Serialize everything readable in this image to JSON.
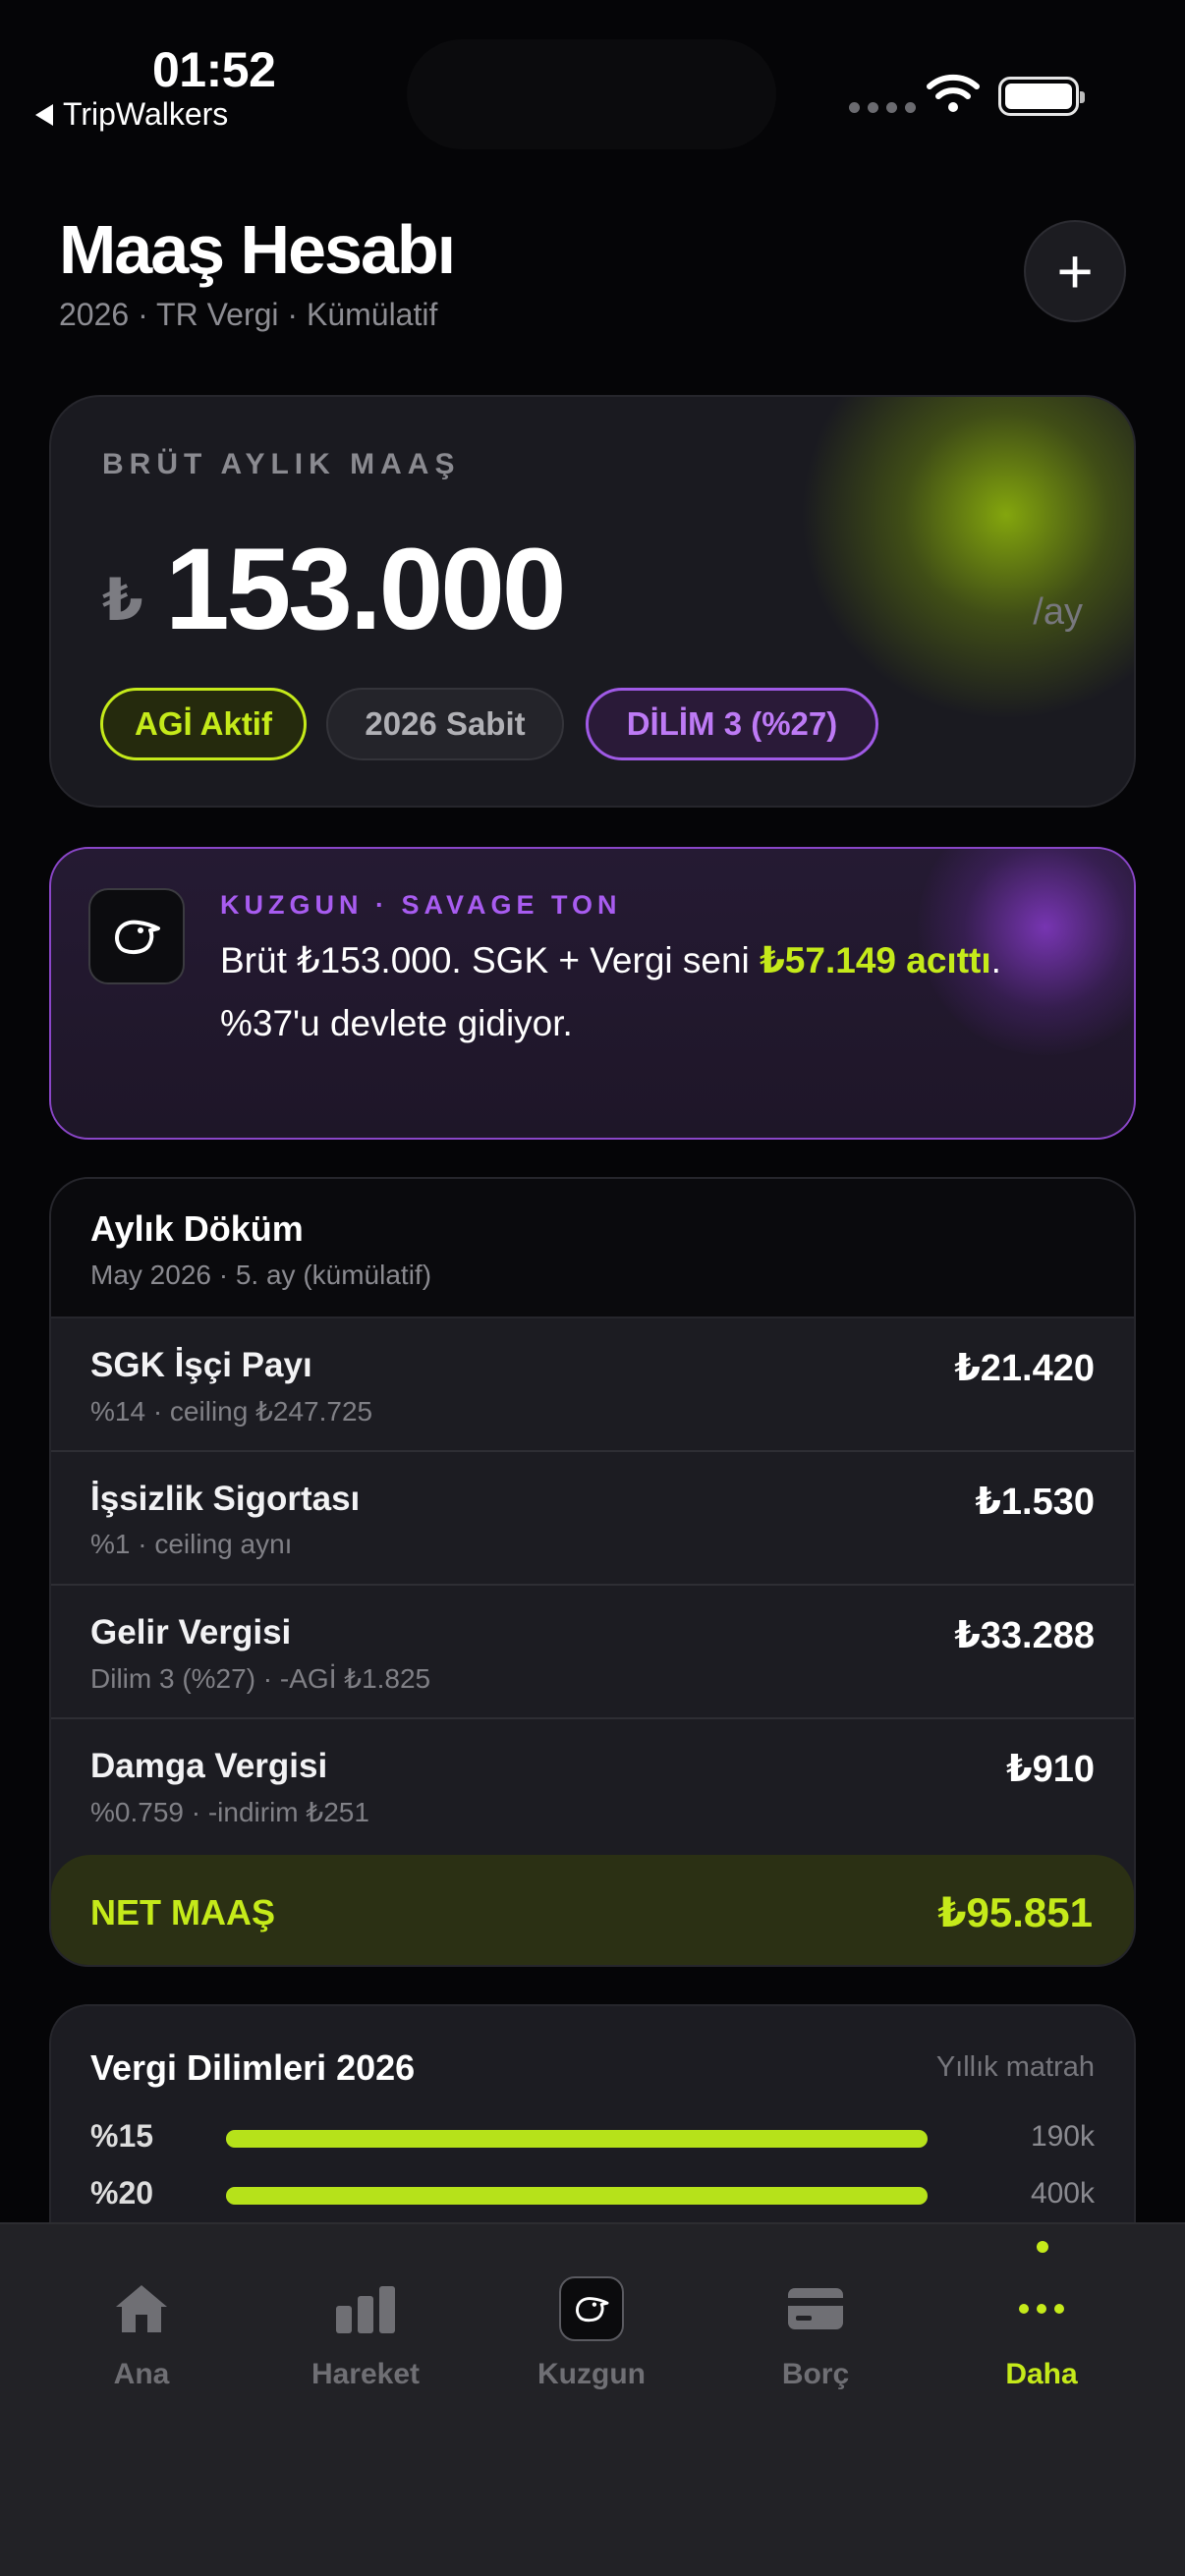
{
  "status": {
    "time": "01:52",
    "back_app": "TripWalkers"
  },
  "header": {
    "title": "Maaş Hesabı",
    "subtitle": "2026 · TR Vergi · Kümülatif",
    "add_label": "+"
  },
  "salary": {
    "label": "BRÜT AYLIK MAAŞ",
    "currency": "₺",
    "value": "153.000",
    "period": "/ay",
    "chips": {
      "agi": "AGİ Aktif",
      "sabit": "2026 Sabit",
      "dilim": "DİLİM 3 (%27)"
    }
  },
  "kuzgun": {
    "tag": "KUZGUN · SAVAGE TON",
    "text_pre": "Brüt ₺153.000. SGK + Vergi seni ",
    "text_highlight": "₺57.149 acıttı",
    "text_post": ". %37'u devlete gidiyor."
  },
  "breakdown": {
    "title": "Aylık Döküm",
    "subtitle": "May 2026 · 5. ay (kümülatif)",
    "rows": [
      {
        "name": "SGK İşçi Payı",
        "desc": "%14 · ceiling ₺247.725",
        "amount": "₺21.420"
      },
      {
        "name": "İşsizlik Sigortası",
        "desc": "%1 · ceiling aynı",
        "amount": "₺1.530"
      },
      {
        "name": "Gelir Vergisi",
        "desc": "Dilim 3 (%27) · -AGİ ₺1.825",
        "amount": "₺33.288"
      },
      {
        "name": "Damga Vergisi",
        "desc": "%0.759 · -indirim ₺251",
        "amount": "₺910"
      }
    ],
    "net_label": "NET MAAŞ",
    "net_value": "₺95.851"
  },
  "brackets": {
    "title": "Vergi Dilimleri 2026",
    "hint": "Yıllık matrah",
    "rows": [
      {
        "label": "%15",
        "value": "190k",
        "fill": 1.0
      },
      {
        "label": "%20",
        "value": "400k",
        "fill": 1.0
      }
    ]
  },
  "tabs": [
    {
      "label": "Ana",
      "icon": "home-icon"
    },
    {
      "label": "Hareket",
      "icon": "bar-chart-icon"
    },
    {
      "label": "Kuzgun",
      "icon": "raven-icon"
    },
    {
      "label": "Borç",
      "icon": "credit-card-icon"
    },
    {
      "label": "Daha",
      "icon": "more-icon",
      "active": true
    }
  ],
  "colors": {
    "accent": "#c5ea1a",
    "purple": "#a85cf0",
    "background": "#050507",
    "card": "#1c1c22"
  }
}
